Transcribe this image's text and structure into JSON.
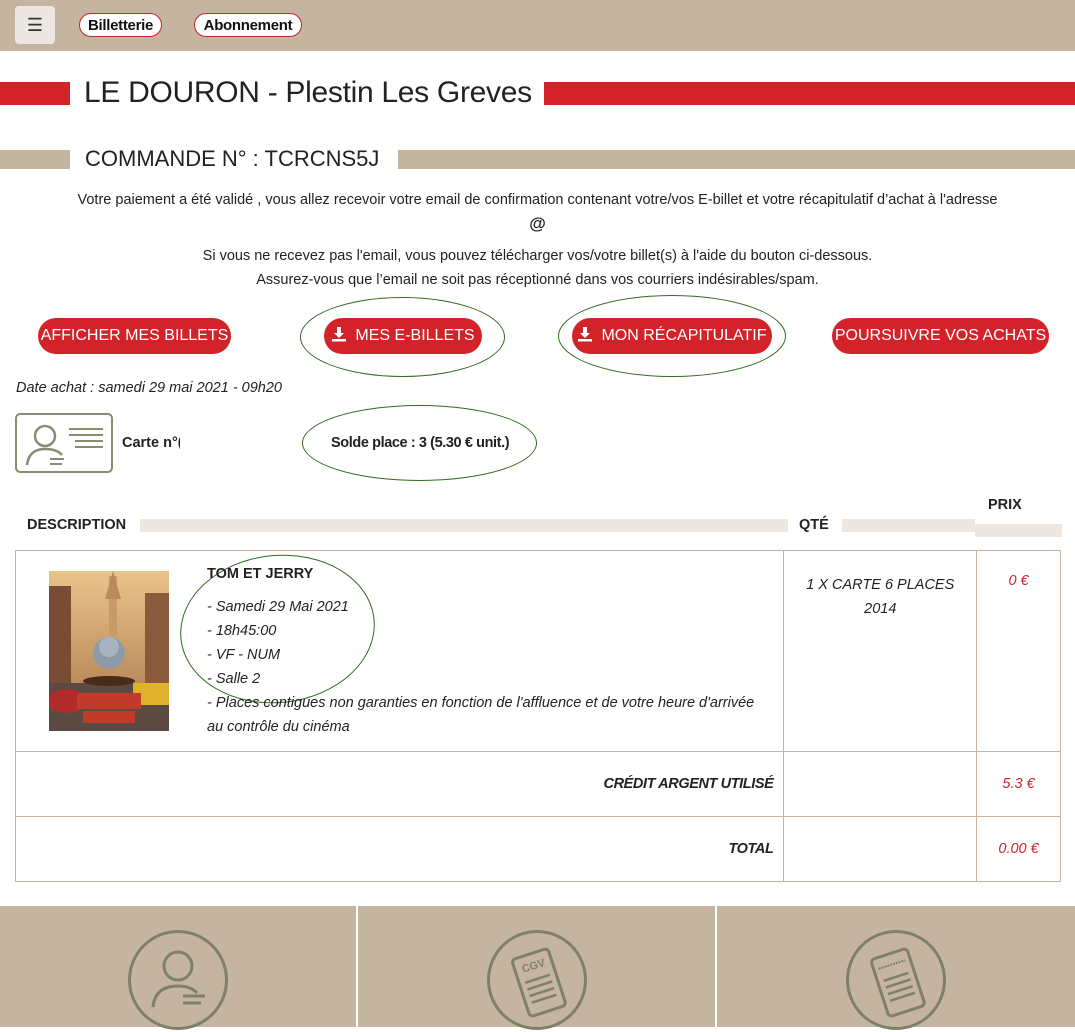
{
  "nav": {
    "menu_icon": "hamburger-icon",
    "billetterie": "Billetterie",
    "abonnement": "Abonnement"
  },
  "header": {
    "title": "LE DOURON - Plestin Les Greves",
    "order": "COMMANDE N° : TCRCNS5J"
  },
  "messages": {
    "line1": "Votre paiement a été validé , vous allez recevoir votre email de confirmation contenant votre/vos E-billet et votre récapitulatif d’achat à l'adresse",
    "email": "@",
    "line2": "Si vous ne recevez pas l'email, vous pouvez télécharger vos/votre billet(s) à l'aide du bouton ci-dessous.",
    "line3": "Assurez-vous que l’email ne soit pas réceptionné dans vos courriers indésirables/spam."
  },
  "actions": {
    "show_tickets": "AFFICHER MES BILLETS",
    "etickets": "MES E-BILLETS",
    "recap": "MON RÉCAPITULATIF",
    "continue": "POURSUIVRE VOS ACHATS"
  },
  "purchase": {
    "date": "Date achat : samedi 29 mai 2021 - 09h20",
    "card_label": "Carte n°(",
    "balance": "Solde place : 3 (5.30 € unit.)"
  },
  "table": {
    "headers": {
      "description": "DESCRIPTION",
      "qty": "QTÉ",
      "price": "PRIX"
    },
    "item": {
      "title": "TOM ET JERRY",
      "lines": [
        "- Samedi 29 Mai 2021",
        "- 18h45:00",
        "- VF - NUM",
        "- Salle 2",
        "- Places contigues non garanties en fonction de l'affluence et de votre heure d'arrivée",
        "au contrôle du cinéma"
      ],
      "qty_line1": "1 X CARTE 6 PLACES",
      "qty_line2": "2014",
      "price": "0 €"
    },
    "credit": {
      "label": "CRÉDIT ARGENT UTILISÉ",
      "value": "5.3 €"
    },
    "total": {
      "label": "TOTAL",
      "value": "0.00 €"
    }
  },
  "footer": {
    "icons": [
      "account-icon",
      "cgv-document-icon",
      "legal-document-icon"
    ],
    "cgv_text": "CGV"
  },
  "colors": {
    "brand_red": "#d2232a",
    "tan": "#c5b5a0",
    "oval_green": "#2f6b1f"
  }
}
